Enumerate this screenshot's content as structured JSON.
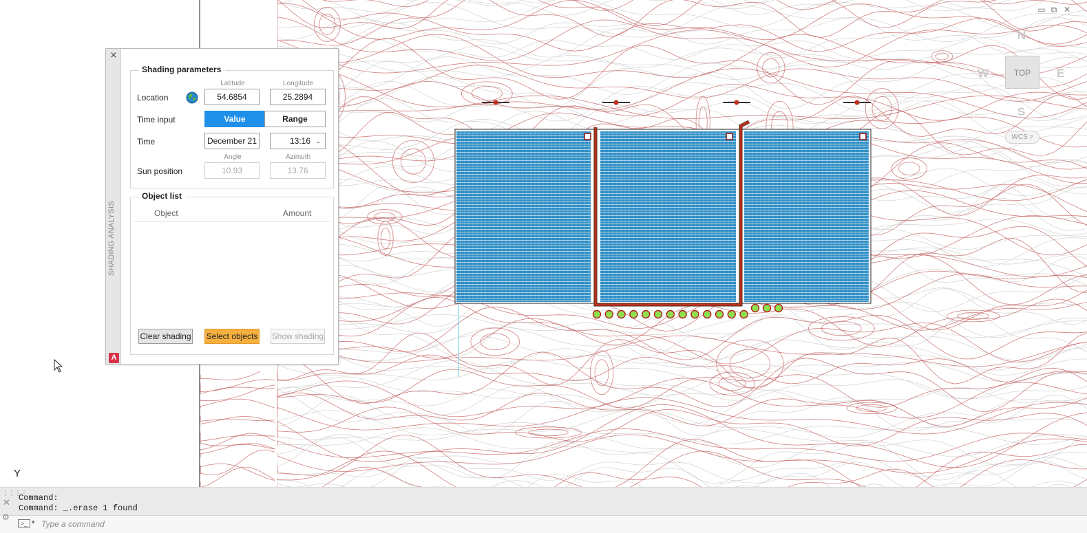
{
  "window_controls": {
    "minimize": "▭",
    "restore": "⧉",
    "close": "✕"
  },
  "viewcube": {
    "north": "N",
    "south": "S",
    "east": "E",
    "west": "W",
    "face": "TOP",
    "wcs": "WCS ▿"
  },
  "palette": {
    "title": "SHADING ANALYSIS",
    "close": "×",
    "logo": "A",
    "shading_parameters": {
      "heading": "Shading parameters",
      "location_label": "Location",
      "latitude_label": "Latitude",
      "longitude_label": "Longitude",
      "latitude": "54.6854",
      "longitude": "25.2894",
      "time_input_label": "Time input",
      "time_input_options": [
        "Value",
        "Range"
      ],
      "time_input_selected": "Value",
      "time_label": "Time",
      "date": "December 21",
      "time": "13:16",
      "sun_position_label": "Sun position",
      "angle_label": "Angle",
      "azimuth_label": "Azimuth",
      "angle": "10.93",
      "azimuth": "13.76"
    },
    "object_list": {
      "heading": "Object list",
      "columns": [
        "Object",
        "Amount"
      ],
      "rows": []
    },
    "buttons": {
      "clear": "Clear shading",
      "select": "Select objects",
      "show": "Show shading"
    }
  },
  "command_line": {
    "history": [
      "Command:",
      "Command: _.erase 1 found"
    ],
    "placeholder": "Type a command",
    "prompt_icon": ">_"
  },
  "ucs": {
    "y_axis": "Y"
  },
  "colors": {
    "contour": "#c86a6a",
    "contour_gray": "#d3d3d3",
    "panel_blue": "#2f8ec5",
    "value_blue": "#1f8fe9",
    "select_orange": "#f6b040",
    "inverter_green": "#8ee04f",
    "cable_red": "#c0301e"
  }
}
